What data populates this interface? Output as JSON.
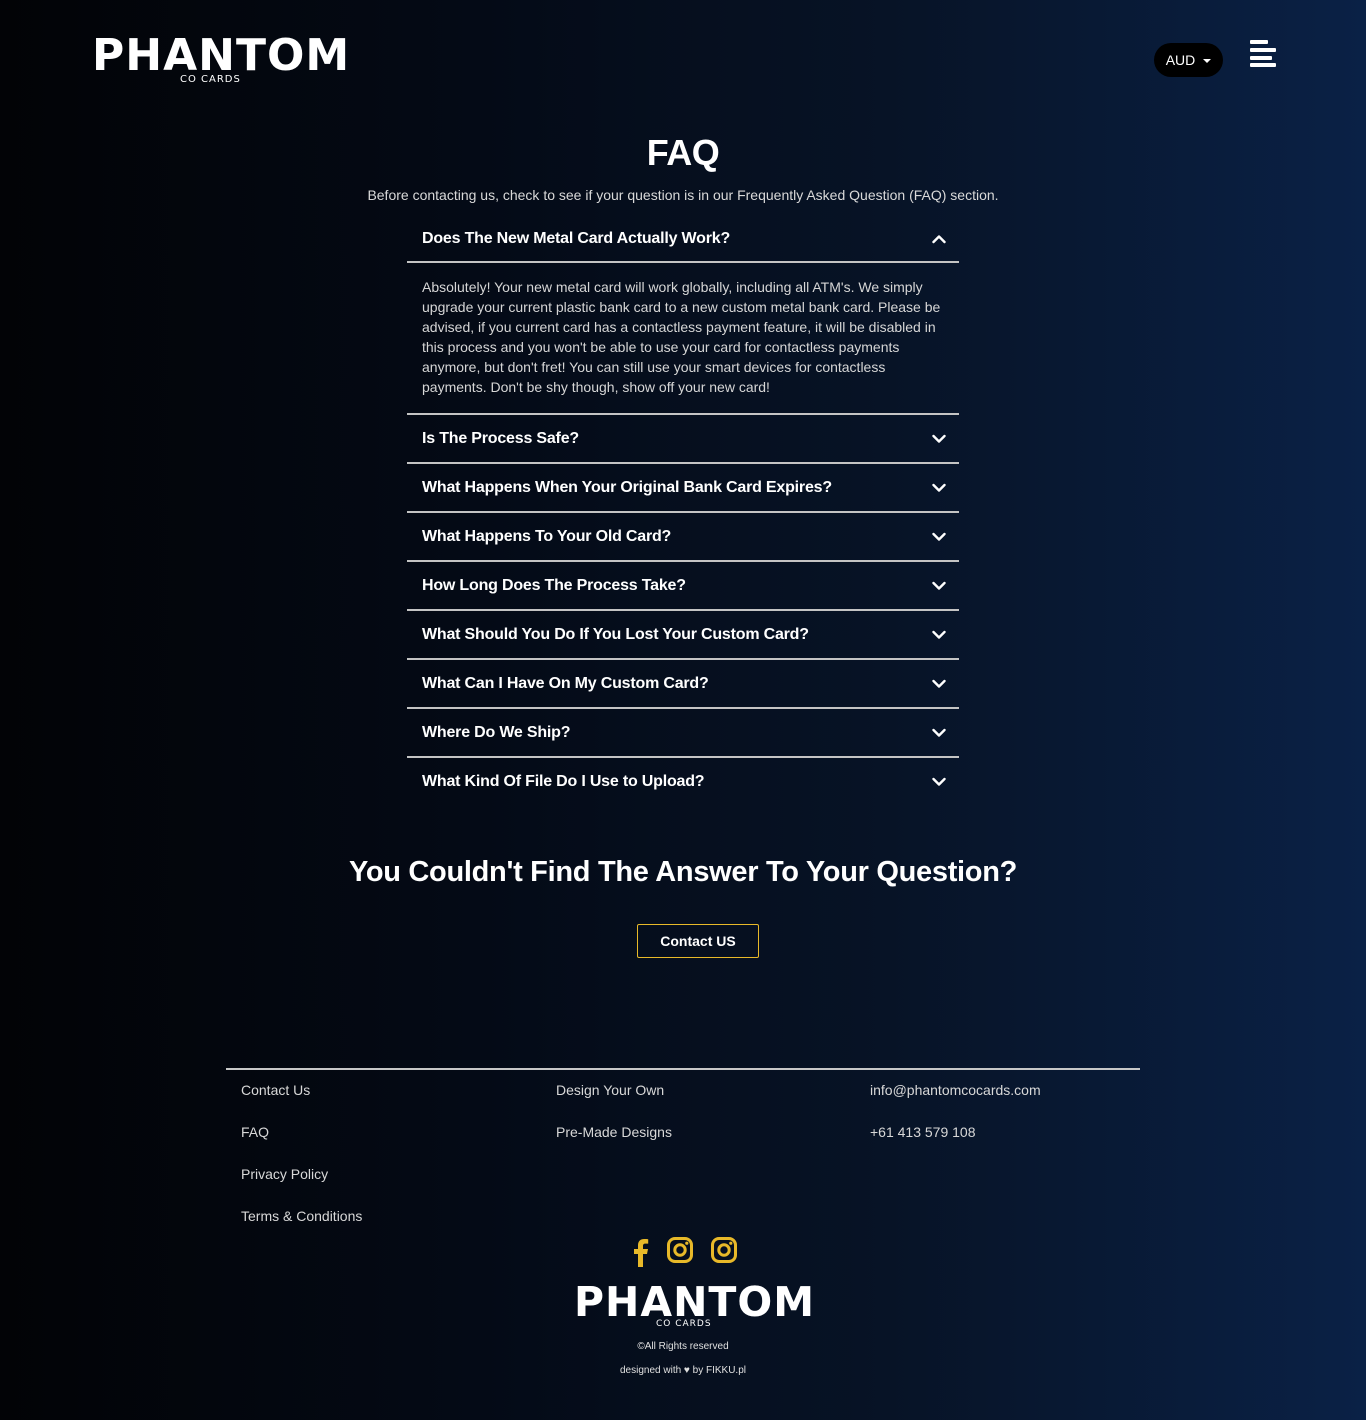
{
  "header": {
    "logo": {
      "word": "PHANTOM",
      "sub": "CO CARDS"
    },
    "currency": "AUD",
    "menu_icon": "hamburger-menu-icon"
  },
  "faq": {
    "title": "FAQ",
    "subtitle": "Before contacting us, check to see if your question is in our Frequently Asked Question (FAQ) section.",
    "items": [
      {
        "question": "Does The New Metal Card Actually Work?",
        "open": true,
        "answer": "Absolutely! Your new metal card will work globally, including all ATM's. We simply upgrade your current plastic bank card to a new custom metal bank card. Please be advised, if you current card has a contactless payment feature, it will be disabled in this process and you won't be able to use your card for contactless payments anymore, but don't fret! You can still use your smart devices for contactless payments. Don't be shy though, show off your new card!"
      },
      {
        "question": "Is The Process Safe?",
        "open": false
      },
      {
        "question": "What Happens When Your Original Bank Card Expires?",
        "open": false
      },
      {
        "question": "What Happens To Your Old Card?",
        "open": false
      },
      {
        "question": "How Long Does The Process Take?",
        "open": false
      },
      {
        "question": "What Should You Do If You Lost Your Custom Card?",
        "open": false
      },
      {
        "question": "What Can I Have On My Custom Card?",
        "open": false
      },
      {
        "question": "Where Do We Ship?",
        "open": false
      },
      {
        "question": "What Kind Of File Do I Use to Upload?",
        "open": false
      }
    ]
  },
  "cta": {
    "heading": "You Couldn't Find The Answer To Your Question?",
    "button": "Contact US"
  },
  "footer": {
    "col1": [
      "Contact Us",
      "FAQ",
      "Privacy Policy",
      "Terms & Conditions"
    ],
    "col2": [
      "Design Your Own",
      "Pre-Made Designs"
    ],
    "col3": [
      "info@phantomcocards.com",
      "+61 413 579 108"
    ],
    "socials": [
      "facebook-icon",
      "instagram-icon",
      "instagram-icon"
    ],
    "accent": "#e8b929",
    "logo": {
      "word": "PHANTOM",
      "sub": "CO CARDS"
    },
    "rights": "©All Rights reserved",
    "credit": "designed with ♥ by FIKKU.pl"
  }
}
